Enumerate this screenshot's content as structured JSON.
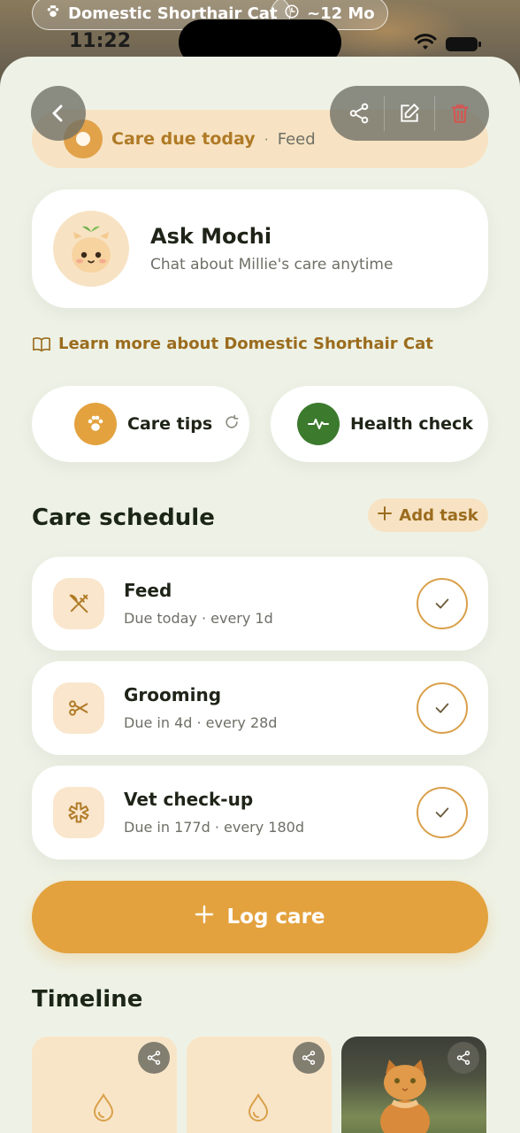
{
  "status_bar": {
    "time": "11:22"
  },
  "header_chips": {
    "breed": "Domestic Shorthair Cat",
    "age": "~12 Mo"
  },
  "care_banner": {
    "title": "Care due today",
    "separator": "·",
    "task": "Feed"
  },
  "ask_card": {
    "title": "Ask Mochi",
    "subtitle": "Chat about Millie's care anytime"
  },
  "learn_link": "Learn more about Domestic Shorthair Cat",
  "quick_actions": {
    "care_tips": "Care tips",
    "health_check": "Health check"
  },
  "schedule": {
    "title": "Care schedule",
    "add_task": "Add task",
    "tasks": [
      {
        "name": "Feed",
        "meta": "Due today · every 1d",
        "icon": "utensils-icon"
      },
      {
        "name": "Grooming",
        "meta": "Due in 4d · every 28d",
        "icon": "scissors-icon"
      },
      {
        "name": "Vet check-up",
        "meta": "Due in 177d · every 180d",
        "icon": "medical-icon"
      }
    ]
  },
  "log_button": "Log care",
  "timeline": {
    "title": "Timeline"
  },
  "colors": {
    "accent": "#e3a23e",
    "background": "#eef2e6",
    "health_green": "#3c7a2e",
    "delete_red": "#d9534f"
  }
}
